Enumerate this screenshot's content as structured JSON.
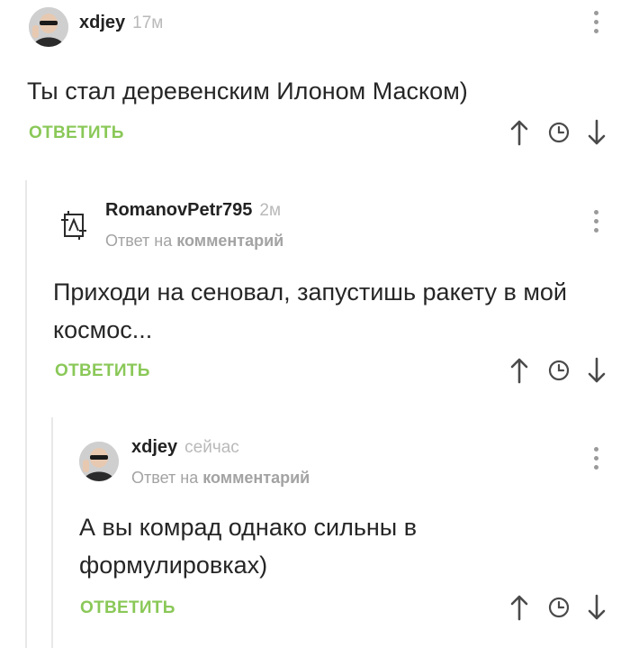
{
  "comments": [
    {
      "author": "xdjey",
      "time": "17м",
      "text": "Ты стал деревенским Илоном Маском)",
      "reply_label": "ОТВЕТИТЬ"
    },
    {
      "author": "RomanovPetr795",
      "time": "2м",
      "reply_prefix": "Ответ на",
      "reply_target": "комментарий",
      "text": "Приходи на сеновал, запустишь ракету в мой космос...",
      "reply_label": "ОТВЕТИТЬ"
    },
    {
      "author": "xdjey",
      "time": "сейчас",
      "reply_prefix": "Ответ на",
      "reply_target": "комментарий",
      "text": "А вы комрад однако сильны в формулировках)",
      "reply_label": "ОТВЕТИТЬ"
    }
  ],
  "icons": {
    "upvote": "arrow-up-icon",
    "time": "clock-icon",
    "downvote": "arrow-down-icon",
    "menu": "more-vertical-icon"
  },
  "colors": {
    "accent": "#8ac858",
    "muted": "#a3a3a3",
    "icon": "#4a4a4a"
  }
}
